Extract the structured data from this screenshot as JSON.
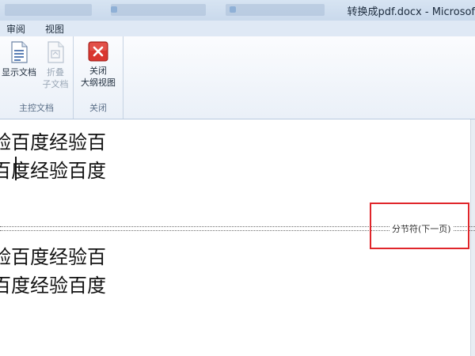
{
  "window": {
    "title": "转换成pdf.docx - Microsof"
  },
  "ribbon_tabs": [
    {
      "label": "审阅"
    },
    {
      "label": "视图"
    }
  ],
  "ribbon": {
    "master_group": {
      "label": "主控文档",
      "show_document": {
        "line1": "显示文档"
      },
      "collapse_subdocuments": {
        "line1": "折叠",
        "line2": "子文档"
      }
    },
    "close_group": {
      "label": "关闭",
      "close_outline": {
        "line1": "关闭",
        "line2": "大纲视图"
      }
    }
  },
  "document": {
    "lines": [
      "验百度经验百",
      "百度经验百度",
      "验百度经验百",
      "百度经验百度"
    ],
    "section_break_label": "分节符(下一页)"
  },
  "colors": {
    "highlight": "#e0262b",
    "close_icon": "#d9362f"
  }
}
